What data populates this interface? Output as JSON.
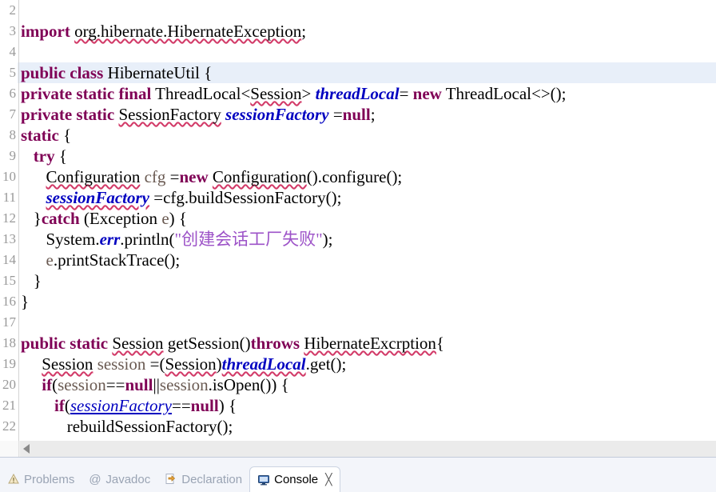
{
  "editor": {
    "language": "java",
    "first_visible_line": 2,
    "current_line": 5,
    "colors": {
      "keyword": "#7F0055",
      "static_field": "#0000C0",
      "string": "#9D53C8",
      "local_var": "#6A5A52",
      "plain": "#000000",
      "line_number": "#999999",
      "current_line_highlight": "#E8EFF9",
      "spellcheck_squiggle": "#D23A68",
      "background": "#FFFFFF"
    },
    "lines": [
      {
        "n": "2",
        "tokens": []
      },
      {
        "n": "3",
        "tokens": [
          {
            "t": "import",
            "c": "kw"
          },
          {
            "t": " ",
            "c": "pln"
          },
          {
            "t": "org.hibernate.HibernateException",
            "c": "sq"
          },
          {
            "t": ";",
            "c": "pln"
          }
        ]
      },
      {
        "n": "4",
        "tokens": []
      },
      {
        "n": "5",
        "tokens": [
          {
            "t": "public class",
            "c": "kw"
          },
          {
            "t": " HibernateUtil {",
            "c": "pln"
          }
        ]
      },
      {
        "n": "6",
        "tokens": [
          {
            "t": "private static final",
            "c": "kw"
          },
          {
            "t": " ThreadLocal<",
            "c": "pln"
          },
          {
            "t": "Session",
            "c": "sq"
          },
          {
            "t": "> ",
            "c": "pln"
          },
          {
            "t": "threadLocal",
            "c": "fld"
          },
          {
            "t": "= ",
            "c": "pln"
          },
          {
            "t": "new",
            "c": "kw"
          },
          {
            "t": " ThreadLocal<>();",
            "c": "pln"
          }
        ]
      },
      {
        "n": "7",
        "tokens": [
          {
            "t": "private static",
            "c": "kw"
          },
          {
            "t": " ",
            "c": "pln"
          },
          {
            "t": "SessionFactory",
            "c": "sq"
          },
          {
            "t": " ",
            "c": "pln"
          },
          {
            "t": "sessionFactory",
            "c": "fld"
          },
          {
            "t": " =",
            "c": "pln"
          },
          {
            "t": "null",
            "c": "kw"
          },
          {
            "t": ";",
            "c": "pln"
          }
        ]
      },
      {
        "n": "8",
        "tokens": [
          {
            "t": "static",
            "c": "kw"
          },
          {
            "t": " {",
            "c": "pln"
          }
        ]
      },
      {
        "n": "9",
        "tokens": [
          {
            "t": "   ",
            "c": "pln"
          },
          {
            "t": "try",
            "c": "kw"
          },
          {
            "t": " {",
            "c": "pln"
          }
        ]
      },
      {
        "n": "10",
        "tokens": [
          {
            "t": "      ",
            "c": "pln"
          },
          {
            "t": "Configuration",
            "c": "sq"
          },
          {
            "t": " ",
            "c": "pln"
          },
          {
            "t": "cfg",
            "c": "loc"
          },
          {
            "t": " =",
            "c": "pln"
          },
          {
            "t": "new",
            "c": "kw"
          },
          {
            "t": " ",
            "c": "pln"
          },
          {
            "t": "Configuration",
            "c": "sq"
          },
          {
            "t": "().configure();",
            "c": "pln"
          }
        ]
      },
      {
        "n": "11",
        "tokens": [
          {
            "t": "      ",
            "c": "pln"
          },
          {
            "t": "sessionFactory",
            "c": "fldsq"
          },
          {
            "t": " =cfg.buildSessionFactory();",
            "c": "pln"
          }
        ]
      },
      {
        "n": "12",
        "tokens": [
          {
            "t": "   }",
            "c": "pln"
          },
          {
            "t": "catch",
            "c": "kw"
          },
          {
            "t": " (Exception ",
            "c": "pln"
          },
          {
            "t": "e",
            "c": "loc"
          },
          {
            "t": ") {",
            "c": "pln"
          }
        ]
      },
      {
        "n": "13",
        "tokens": [
          {
            "t": "      System.",
            "c": "pln"
          },
          {
            "t": "err",
            "c": "fld"
          },
          {
            "t": ".println(",
            "c": "pln"
          },
          {
            "t": "\"创建会话工厂失败\"",
            "c": "str"
          },
          {
            "t": ");",
            "c": "pln"
          }
        ]
      },
      {
        "n": "14",
        "tokens": [
          {
            "t": "      ",
            "c": "pln"
          },
          {
            "t": "e",
            "c": "loc"
          },
          {
            "t": ".printStackTrace();",
            "c": "pln"
          }
        ]
      },
      {
        "n": "15",
        "tokens": [
          {
            "t": "   }",
            "c": "pln"
          }
        ]
      },
      {
        "n": "16",
        "tokens": [
          {
            "t": "}",
            "c": "pln"
          }
        ]
      },
      {
        "n": "17",
        "tokens": []
      },
      {
        "n": "18",
        "tokens": [
          {
            "t": "public static",
            "c": "kw"
          },
          {
            "t": " ",
            "c": "pln"
          },
          {
            "t": "Session",
            "c": "sq"
          },
          {
            "t": " getSession()",
            "c": "pln"
          },
          {
            "t": "throws",
            "c": "kw"
          },
          {
            "t": " ",
            "c": "pln"
          },
          {
            "t": "HibernateExcrption",
            "c": "sq"
          },
          {
            "t": "{",
            "c": "pln"
          }
        ]
      },
      {
        "n": "19",
        "tokens": [
          {
            "t": "     ",
            "c": "pln"
          },
          {
            "t": "Session",
            "c": "sq"
          },
          {
            "t": " ",
            "c": "pln"
          },
          {
            "t": "session",
            "c": "loc"
          },
          {
            "t": " =(",
            "c": "pln"
          },
          {
            "t": "Session",
            "c": "sq"
          },
          {
            "t": ")",
            "c": "pln"
          },
          {
            "t": "threadLocal",
            "c": "fldsq"
          },
          {
            "t": ".get();",
            "c": "pln"
          }
        ]
      },
      {
        "n": "20",
        "tokens": [
          {
            "t": "     ",
            "c": "pln"
          },
          {
            "t": "if",
            "c": "kw"
          },
          {
            "t": "(",
            "c": "pln"
          },
          {
            "t": "session",
            "c": "loc"
          },
          {
            "t": "==",
            "c": "pln"
          },
          {
            "t": "null",
            "c": "kw"
          },
          {
            "t": "||",
            "c": "pln"
          },
          {
            "t": "session",
            "c": "loc"
          },
          {
            "t": ".isOpen()) {",
            "c": "pln"
          }
        ]
      },
      {
        "n": "21",
        "tokens": [
          {
            "t": "        ",
            "c": "pln"
          },
          {
            "t": "if",
            "c": "kw"
          },
          {
            "t": "(",
            "c": "pln"
          },
          {
            "t": "sessionFactory",
            "c": "fld2"
          },
          {
            "t": "==",
            "c": "pln"
          },
          {
            "t": "null",
            "c": "kw"
          },
          {
            "t": ") {",
            "c": "pln"
          }
        ]
      },
      {
        "n": "22",
        "tokens": [
          {
            "t": "           rebuildSessionFactory();",
            "c": "pln"
          }
        ]
      }
    ]
  },
  "hscroll": {
    "left_arrow": "scroll-left-arrow"
  },
  "tabbar": {
    "tabs": [
      {
        "label": "Problems",
        "icon": "problems-icon",
        "active": false,
        "closable": false
      },
      {
        "label": "Javadoc",
        "icon": "javadoc-icon",
        "active": false,
        "closable": false
      },
      {
        "label": "Declaration",
        "icon": "declaration-icon",
        "active": false,
        "closable": false
      },
      {
        "label": "Console",
        "icon": "console-icon",
        "active": true,
        "closable": true,
        "close_glyph": "╳"
      }
    ]
  }
}
